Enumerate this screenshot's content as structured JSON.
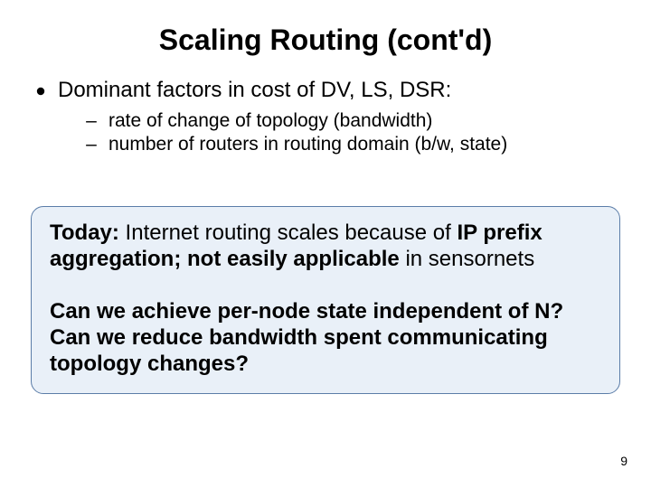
{
  "title": "Scaling Routing (cont'd)",
  "bullet1": "Dominant factors in cost of DV, LS, DSR:",
  "sub": [
    "rate of change of topology (bandwidth)",
    "number of routers in routing domain (b/w, state)"
  ],
  "callout": {
    "p1": {
      "lead": "Today:",
      "mid": " Internet routing scales because of ",
      "b1": "IP prefix aggregation; not",
      "mid2": " ",
      "b2": "easily applicable",
      "tail": " in sensornets"
    },
    "p2": {
      "q1a": "Can we achieve ",
      "q1b": "per-node state independent of N?",
      "q2a": "Can we ",
      "q2b": "reduce bandwidth spent communicating topology changes?"
    }
  },
  "dash": "–",
  "page": "9"
}
